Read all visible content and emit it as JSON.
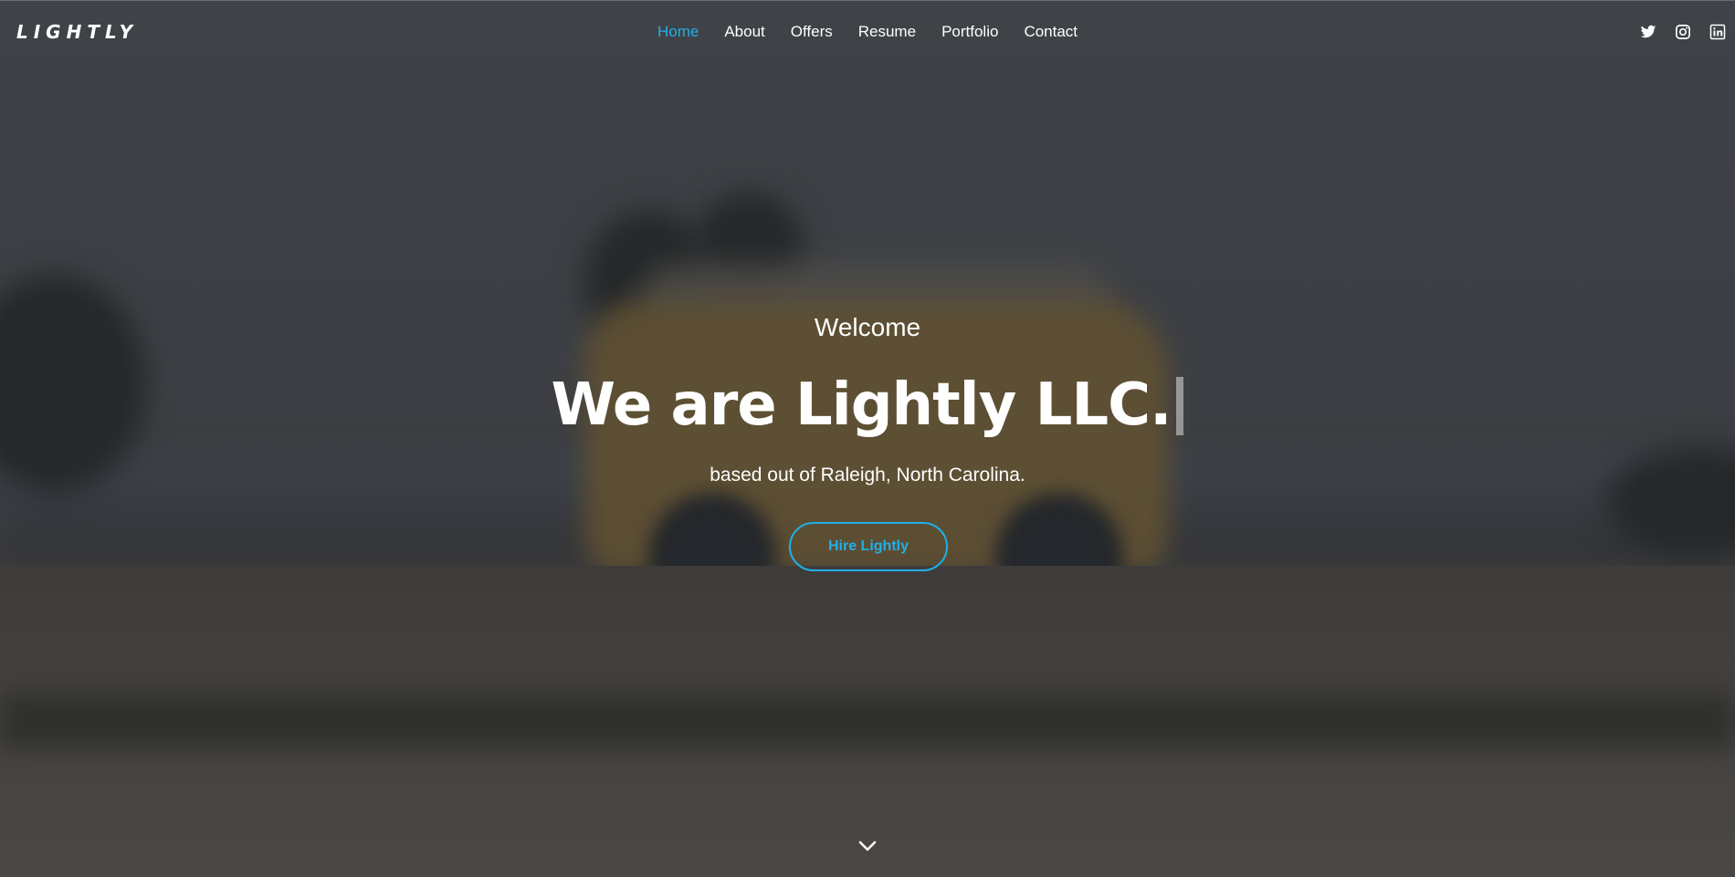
{
  "brand": {
    "name": "LIGHTLY"
  },
  "nav": {
    "items": [
      {
        "label": "Home",
        "active": true
      },
      {
        "label": "About",
        "active": false
      },
      {
        "label": "Offers",
        "active": false
      },
      {
        "label": "Resume",
        "active": false
      },
      {
        "label": "Portfolio",
        "active": false
      },
      {
        "label": "Contact",
        "active": false
      }
    ]
  },
  "social": [
    {
      "icon": "twitter-icon"
    },
    {
      "icon": "instagram-icon"
    },
    {
      "icon": "linkedin-icon"
    }
  ],
  "hero": {
    "welcome": "Welcome",
    "headline": "We are Lightly LLC.",
    "subtitle": "based out of Raleigh, North Carolina.",
    "cta_label": "Hire Lightly",
    "scroll_icon": "chevron-down-icon"
  },
  "colors": {
    "accent": "#20b0e8",
    "text": "#ffffff",
    "overlay": "#3d4044"
  }
}
